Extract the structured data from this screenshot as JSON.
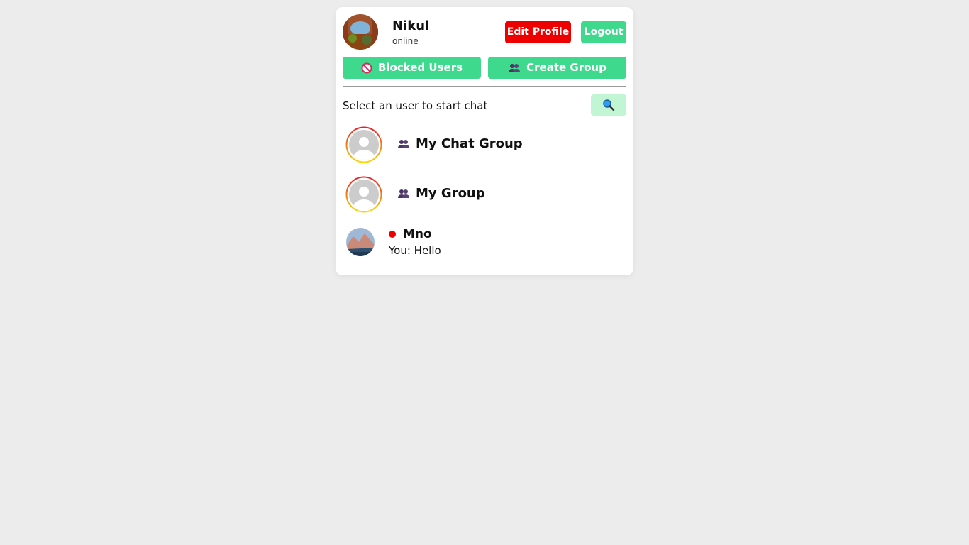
{
  "profile": {
    "name": "Nikul",
    "status": "online",
    "avatar_icon": "user-photo-avatar"
  },
  "header_buttons": {
    "edit_profile": "Edit Profile",
    "logout": "Logout"
  },
  "actions": {
    "blocked_users": "Blocked Users",
    "blocked_icon": "prohibited-icon",
    "create_group": "Create Group",
    "create_group_icon": "people-icon"
  },
  "chat_list": {
    "hint": "Select an user to start chat",
    "search_icon": "search-icon",
    "groups": [
      {
        "name": "My Chat Group",
        "icon": "people-icon"
      },
      {
        "name": "My Group",
        "icon": "people-icon"
      }
    ],
    "direct": [
      {
        "name": "Mno",
        "preview": "You: Hello",
        "presence_color": "#ee0000"
      }
    ]
  },
  "colors": {
    "accent_green": "#3fd98e",
    "danger_red": "#ee0000",
    "search_bg": "#c2f5d4",
    "page_bg": "#ececec"
  }
}
